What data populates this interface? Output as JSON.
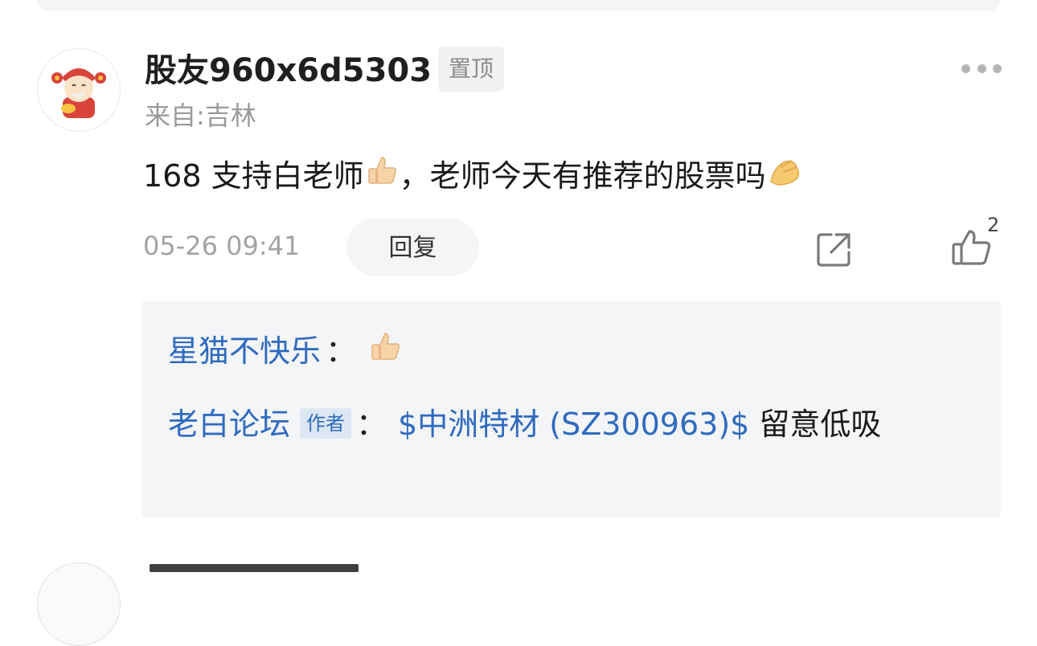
{
  "post": {
    "username": "股友960x6d5303",
    "pin_label": "置顶",
    "location": "来自:吉林",
    "content_before": "168 支持白老师",
    "content_after": "，老师今天有推荐的股票吗",
    "timestamp": "05-26 09:41",
    "reply_label": "回复",
    "like_count": "2",
    "icons": {
      "more": "more-dots-icon",
      "share": "share-icon",
      "like": "thumbs-up-icon",
      "emoji_1": "thumbs-up-emoji",
      "emoji_2": "pinched-hand-emoji"
    }
  },
  "replies": [
    {
      "name": "星猫不快乐",
      "colon": "：",
      "emoji": "thumbs-up-emoji"
    },
    {
      "name": "老白论坛",
      "badge": "作者",
      "colon": "：",
      "stock": "$中洲特材 (SZ300963)$",
      "text": " 留意低吸"
    }
  ],
  "colors": {
    "link_blue": "#2f6bbf",
    "muted_gray": "#9a9a9a",
    "panel_bg": "#f4f5f7"
  }
}
